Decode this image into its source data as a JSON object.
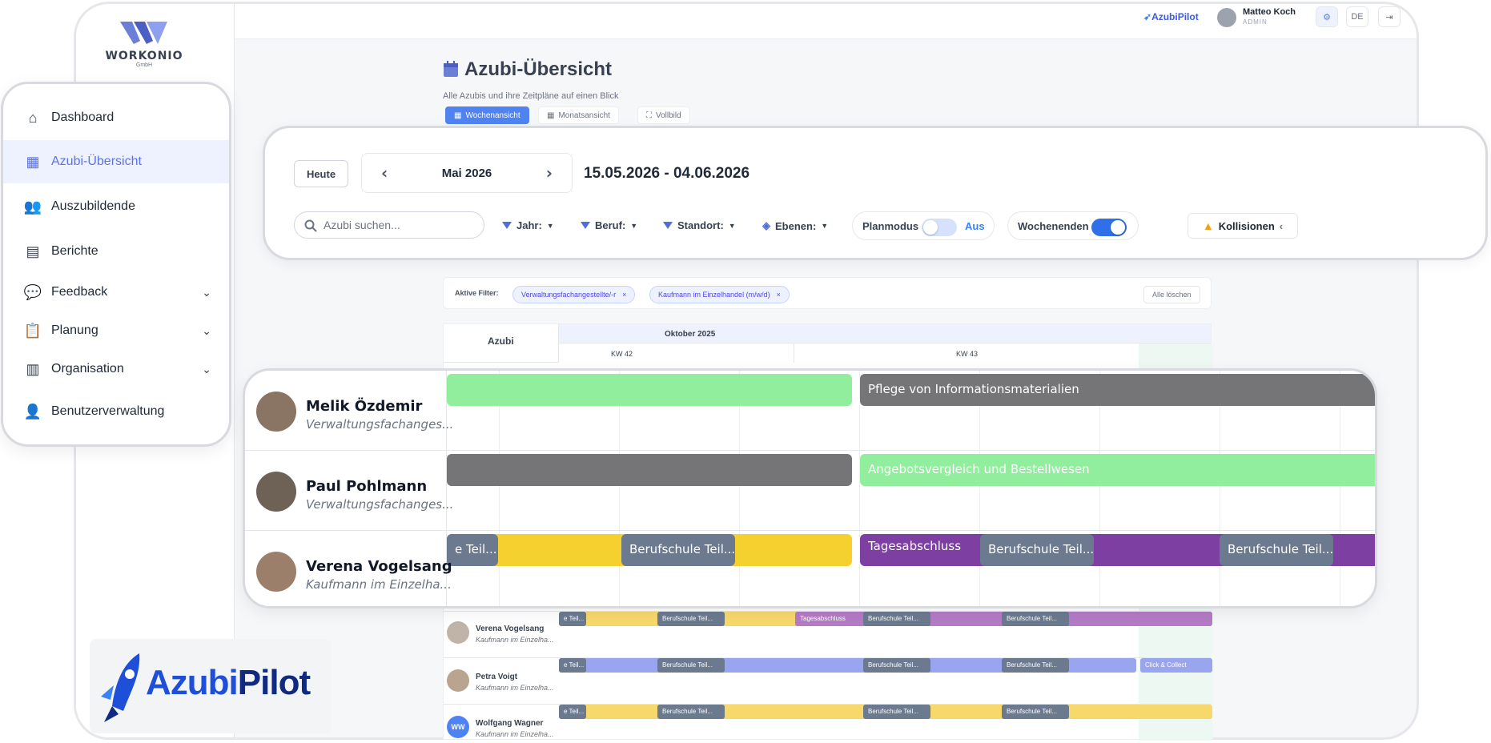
{
  "company": {
    "name": "WORKONIO",
    "sub": "GmbH"
  },
  "topbar": {
    "brand": "AzubiPilot",
    "user_name": "Matteo Koch",
    "user_role": "ADMIN",
    "lang": "DE"
  },
  "page": {
    "title": "Azubi-Übersicht",
    "subtitle": "Alle Azubis und ihre Zeitpläne auf einen Blick",
    "view_tabs": [
      "Wochenansicht",
      "Monatsansicht",
      "Vollbild"
    ]
  },
  "toolbar": {
    "today": "Heute",
    "month": "Mai 2026",
    "range": "15.05.2026 - 04.06.2026",
    "search_placeholder": "Azubi suchen...",
    "filters": [
      "Jahr:",
      "Beruf:",
      "Standort:",
      "Ebenen:"
    ],
    "planmodus_label": "Planmodus",
    "planmodus_state": "Aus",
    "weekends_label": "Wochenenden",
    "collisions": "Kollisionen"
  },
  "active_filters": {
    "label": "Aktive Filter:",
    "chips": [
      "Verwaltungsfachangestellte/-r",
      "Kaufmann im Einzelhandel (m/w/d)"
    ],
    "clear": "Alle löschen"
  },
  "grid_header": {
    "col": "Azubi",
    "month": "Oktober 2025",
    "weeks": [
      "KW 42",
      "KW 43"
    ]
  },
  "nav": {
    "items": [
      {
        "label": "Dashboard",
        "icon": "home-icon"
      },
      {
        "label": "Azubi-Übersicht",
        "icon": "calendar-icon"
      },
      {
        "label": "Auszubildende",
        "icon": "users-icon"
      },
      {
        "label": "Berichte",
        "icon": "document-icon"
      },
      {
        "label": "Feedback",
        "icon": "chat-icon"
      },
      {
        "label": "Planung",
        "icon": "clipboard-icon"
      },
      {
        "label": "Organisation",
        "icon": "building-icon"
      },
      {
        "label": "Benutzerverwaltung",
        "icon": "user-gear-icon"
      }
    ]
  },
  "timeline": {
    "rows": [
      {
        "name": "Melik Özdemir",
        "role": "Verwaltungsfachanges...",
        "bars": [
          "",
          "Pflege von Informationsmaterialien"
        ]
      },
      {
        "name": "Paul Pohlmann",
        "role": "Verwaltungsfachanges...",
        "bars": [
          "",
          "Angebotsvergleich und Bestellwesen"
        ]
      },
      {
        "name": "Verena Vogelsang",
        "role": "Kaufmann im Einzelha...",
        "bars": [
          "e Teil...",
          "Berufschule Teil...",
          "Tagesabschluss",
          "Berufschule Teil...",
          "Berufschule Teil..."
        ]
      }
    ]
  },
  "bg_rows": [
    {
      "name": "Verena Vogelsang",
      "role": "Kaufmann im Einzelha...",
      "bars": [
        "e Teil...",
        "Berufschule Teil...",
        "Tagesabschluss",
        "Berufschule Teil...",
        "Berufschule Teil..."
      ]
    },
    {
      "name": "Petra Voigt",
      "role": "Kaufmann im Einzelha...",
      "bars": [
        "e Teil...",
        "Berufschule Teil...",
        "Berufschule Teil...",
        "Berufschule Teil...",
        "Click & Collect"
      ]
    },
    {
      "name": "Wolfgang Wagner",
      "role": "Kaufmann im Einzelha...",
      "initials": "WW",
      "bars": [
        "e Teil...",
        "Berufschule Teil...",
        "Berufschule Teil...",
        "Berufschule Teil..."
      ]
    }
  ],
  "bottom_logo": {
    "part1": "Azubi",
    "part2": "Pilot"
  },
  "colors": {
    "accent": "#4f83f1",
    "green": "#90ee9d",
    "gray": "#757578",
    "yellow": "#f5d12f",
    "purple": "#7e3fa3",
    "slate": "#6b7a8f",
    "periwinkle": "#9aa5f0"
  }
}
